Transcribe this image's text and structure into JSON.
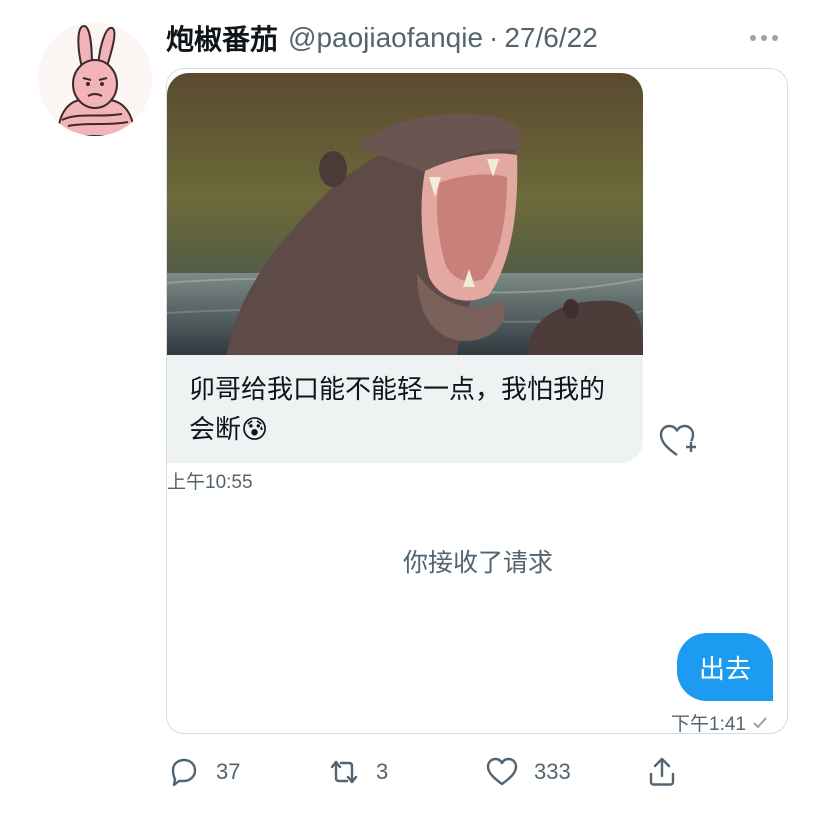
{
  "tweet": {
    "display_name": "炮椒番茄",
    "handle": "@paojiaofanqie",
    "separator": "·",
    "date": "27/6/22"
  },
  "icons": {
    "avatar": "pink-bunny-avatar",
    "more": "more-horizontal-icon",
    "react": "heart-plus-icon",
    "reply": "reply-icon",
    "retweet": "retweet-icon",
    "like": "like-icon",
    "share": "share-icon",
    "read_receipt": "check-icon"
  },
  "dm": {
    "incoming": {
      "image_alt": "hippo with mouth wide open",
      "text": "卯哥给我口能不能轻一点，我怕我的会断😰",
      "time": "上午10:55"
    },
    "system_message": "你接收了请求",
    "outgoing": {
      "text": "出去",
      "time": "下午1:41"
    }
  },
  "metrics": {
    "replies": "37",
    "retweets": "3",
    "likes": "333"
  },
  "colors": {
    "accent": "#1d9bf0",
    "muted_text": "#536471",
    "incoming_bubble": "#eff2f3",
    "card_border": "#d6dde2"
  }
}
